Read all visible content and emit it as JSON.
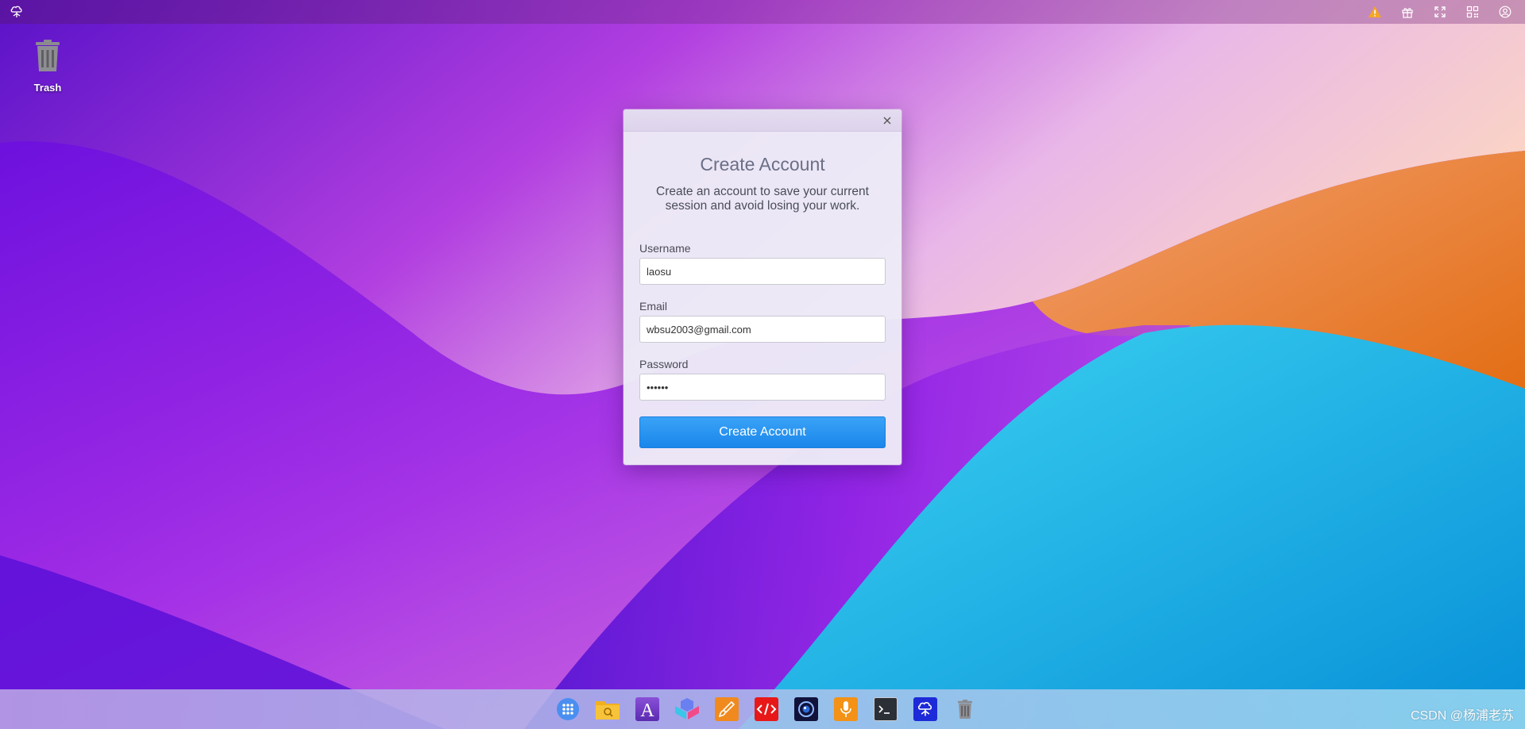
{
  "topbar": {
    "logo_icon": "cloud-tree-logo-icon",
    "right_icons": [
      "warning-icon",
      "gift-icon",
      "fullscreen-icon",
      "qr-code-icon",
      "user-icon"
    ]
  },
  "desktop": {
    "items": [
      {
        "label": "Trash",
        "icon": "trash-icon"
      }
    ]
  },
  "dialog": {
    "title": "Create Account",
    "description": "Create an account to save your current session and avoid losing your work.",
    "fields": {
      "username": {
        "label": "Username",
        "value": "laosu"
      },
      "email": {
        "label": "Email",
        "value": "wbsu2003@gmail.com"
      },
      "password": {
        "label": "Password",
        "value": "laosu1"
      }
    },
    "submit_label": "Create Account",
    "close_icon": "close-icon"
  },
  "taskbar": {
    "apps": [
      "app-launcher-icon",
      "file-explorer-icon",
      "font-editor-icon",
      "cubes-app-icon",
      "paint-brush-icon",
      "code-editor-icon",
      "camera-icon",
      "recorder-icon",
      "terminal-icon",
      "cloud-tree-app-icon",
      "trash-icon"
    ]
  },
  "watermark": "CSDN @杨浦老苏",
  "colors": {
    "accent": "#1a86ea",
    "warning": "#f5a623"
  }
}
